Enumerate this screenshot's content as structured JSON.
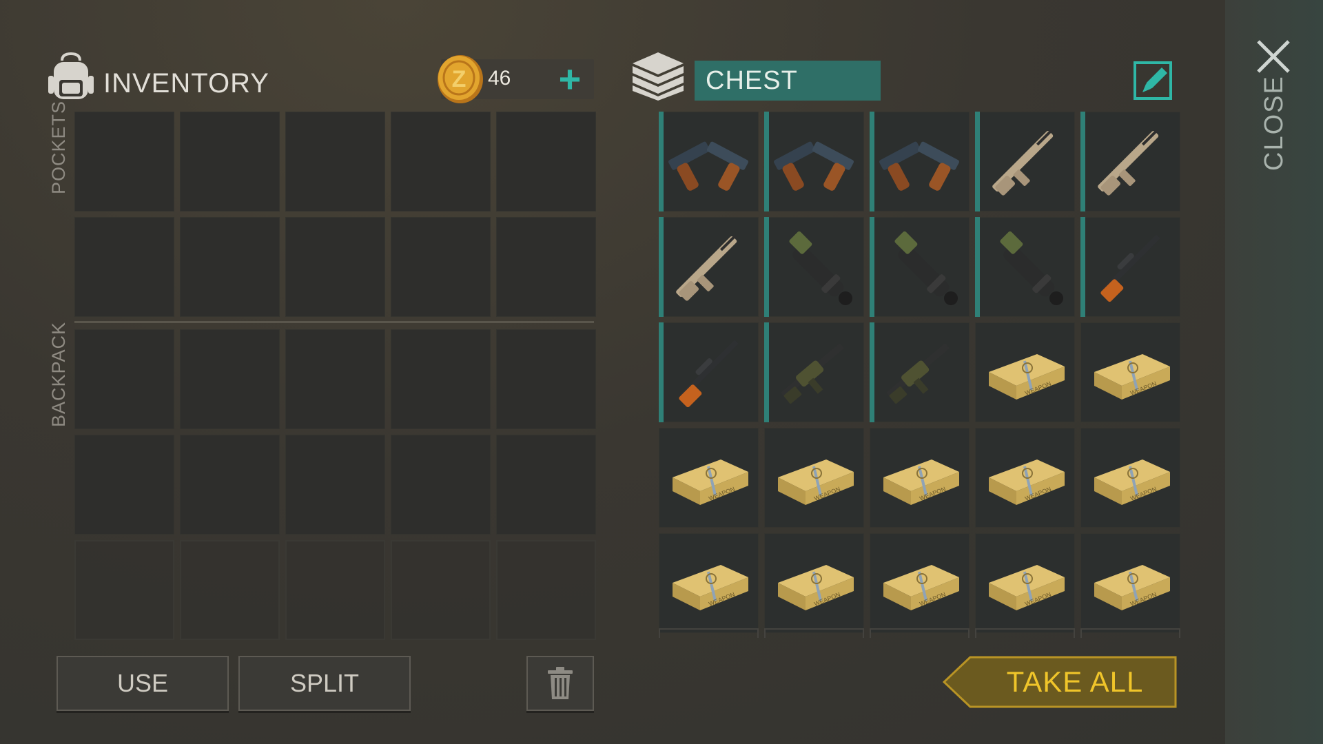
{
  "inventory": {
    "title": "INVENTORY",
    "coins": "46",
    "pockets_label": "POCKETS",
    "backpack_label": "BACKPACK"
  },
  "buttons": {
    "use": "USE",
    "split": "SPLIT"
  },
  "chest": {
    "title": "CHEST",
    "take_all": "TAKE ALL",
    "close": "CLOSE",
    "items": [
      "dual-pistols",
      "dual-pistols",
      "dual-pistols",
      "assault-rifle",
      "assault-rifle",
      "assault-rifle",
      "grenade-launcher",
      "grenade-launcher",
      "grenade-launcher",
      "sniper-rifle",
      "sniper-rifle",
      "tactical-rifle",
      "tactical-rifle",
      "weapon-crate",
      "weapon-crate",
      "weapon-crate",
      "weapon-crate",
      "weapon-crate",
      "weapon-crate",
      "weapon-crate",
      "weapon-crate",
      "weapon-crate",
      "weapon-crate",
      "weapon-crate",
      "weapon-crate"
    ]
  },
  "colors": {
    "accent_teal": "#2f8077",
    "take_all_gold": "#f0c52a",
    "chest_title_bg": "#2f6f67"
  }
}
